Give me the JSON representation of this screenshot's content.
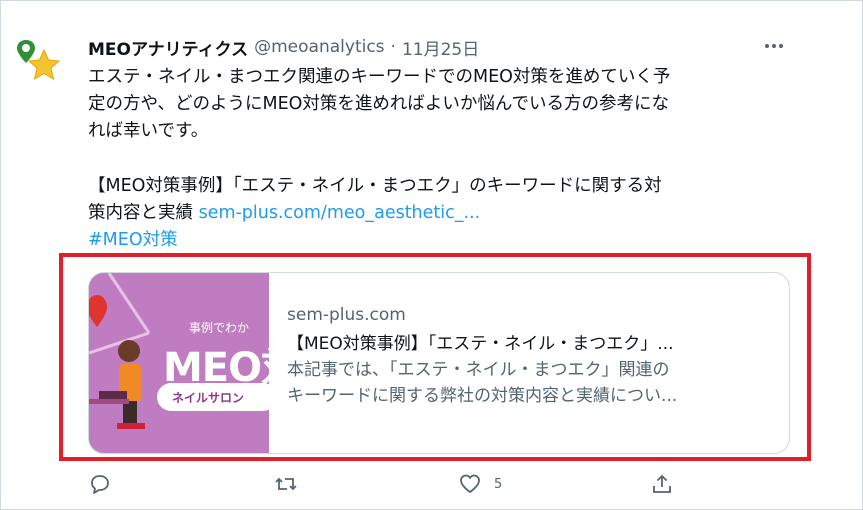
{
  "tweet": {
    "author_name": "MEOアナリティクス",
    "handle": "@meoanalytics",
    "separator": "·",
    "date": "11月25日",
    "text_lines": [
      "エステ・ネイル・まつエク関連のキーワードでのMEO対策を進めていく予",
      "定の方や、どのようにMEO対策を進めればよいか悩んでいる方の参考にな",
      "れば幸いです。"
    ],
    "text_line4": "【MEO対策事例】「エステ・ネイル・まつエク」のキーワードに関する対",
    "text_line5_prefix": "策内容と実績 ",
    "link_text": "sem-plus.com/meo_aesthetic_...",
    "hashtag": "#MEO対策"
  },
  "card": {
    "domain": "sem-plus.com",
    "title": "【MEO対策事例】「エステ・ネイル・まつエク」...",
    "description_line1": "本記事では、「エステ・ネイル・まつエク」関連の",
    "description_line2": "キーワードに関する弊社の対策内容と実績につい...",
    "thumbnail": {
      "small_caption": "事例でわか",
      "big_text": "MEO対",
      "pill_text": "ネイルサロン"
    }
  },
  "actions": {
    "reply_icon": "reply-icon",
    "retweet_icon": "retweet-icon",
    "like_icon": "heart-icon",
    "like_count": "5",
    "share_icon": "share-icon"
  },
  "colors": {
    "link": "#1d9bf0",
    "highlight_box": "#e01f26",
    "thumbnail_bg": "#c07cc0",
    "secondary_text": "#536471"
  }
}
